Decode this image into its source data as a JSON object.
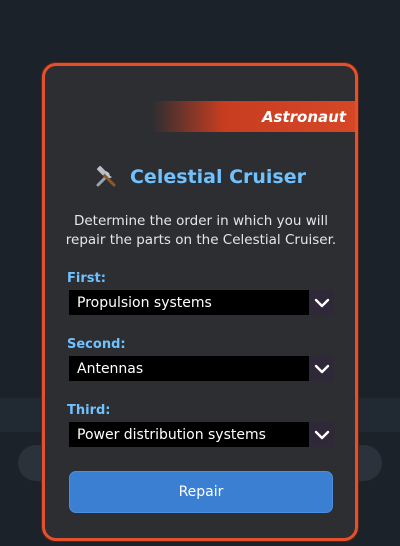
{
  "banner": {
    "role": "Astronaut"
  },
  "header": {
    "title": "Celestial Cruiser",
    "icon": "tools-icon"
  },
  "description": "Determine the order in which you will repair the parts on the Celestial Cruiser.",
  "fields": [
    {
      "label": "First:",
      "selected": "Propulsion systems"
    },
    {
      "label": "Second:",
      "selected": "Antennas"
    },
    {
      "label": "Third:",
      "selected": "Power distribution systems"
    }
  ],
  "actions": {
    "repair_label": "Repair"
  },
  "colors": {
    "accent_border": "#e2502e",
    "title_blue": "#6fc1ff",
    "button_blue": "#3b7fd3",
    "dialog_bg": "#2d2e31"
  }
}
